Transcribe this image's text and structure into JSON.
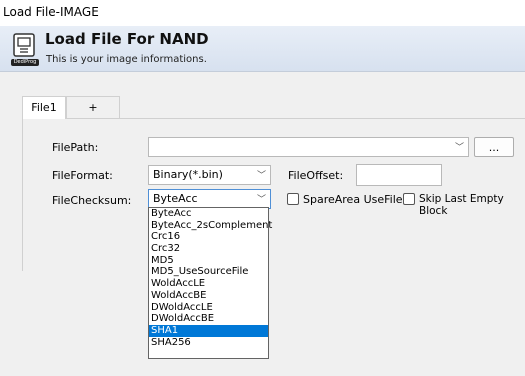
{
  "window": {
    "title": "Load File-IMAGE"
  },
  "header": {
    "title": "Load File For NAND",
    "subtitle": "This is your image informations.",
    "logo_text": "DediProg"
  },
  "tabs": [
    {
      "label": "File1"
    },
    {
      "label": "+"
    }
  ],
  "form": {
    "filepath": {
      "label": "FilePath:",
      "value": "",
      "browse_label": "..."
    },
    "fileformat": {
      "label": "FileFormat:",
      "value": "Binary(*.bin)"
    },
    "fileoffset": {
      "label": "FileOffset:",
      "value": ""
    },
    "filechecksum": {
      "label": "FileChecksum:",
      "value": "ByteAcc"
    },
    "spare_area": {
      "label": "SpareArea UseFile",
      "checked": false
    },
    "skip_last": {
      "label": "Skip Last Empty Block",
      "checked": false
    }
  },
  "checksum_options": [
    "ByteAcc",
    "ByteAcc_2sComplement",
    "Crc16",
    "Crc32",
    "MD5",
    "MD5_UseSourceFile",
    "WoldAccLE",
    "WoldAccBE",
    "DWoldAccLE",
    "DWoldAccBE",
    "SHA1",
    "SHA256"
  ],
  "checksum_highlighted": "SHA1",
  "icons": {
    "dropdown_arrow": "chevron-down-icon",
    "logo": "dediprog-logo-icon"
  },
  "colors": {
    "selection": "#0078d7",
    "header_gradient_top": "#e8eef7",
    "header_gradient_bottom": "#d7e1ef"
  }
}
